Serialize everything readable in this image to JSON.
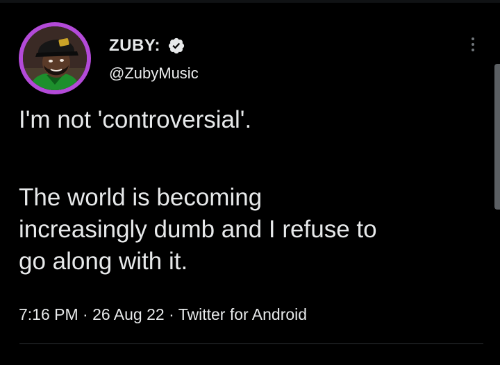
{
  "tweet": {
    "author": {
      "display_name": "ZUBY:",
      "handle": "@ZubyMusic",
      "verified_icon": "verified-badge-icon"
    },
    "text_paragraph_1": "I'm not 'controversial'.",
    "text_paragraph_2": "The world is becoming\nincreasingly dumb and I refuse to\ngo along with it.",
    "meta": "7:16 PM · 26 Aug 22 · Twitter for Android",
    "more_icon": "vertical-ellipsis-icon"
  },
  "colors": {
    "background": "#000000",
    "text": "#e7e9ea",
    "secondary": "#71767b",
    "avatar_ring": "#b34ad8",
    "divider": "#2f3336"
  }
}
